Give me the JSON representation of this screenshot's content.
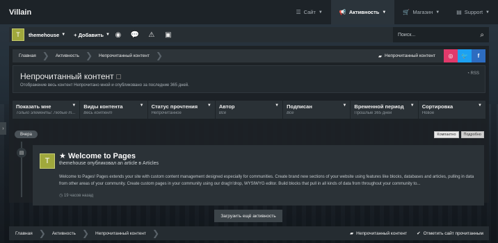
{
  "app": {
    "brand": "Villain"
  },
  "topnav": {
    "items": [
      {
        "icon": "list-icon",
        "label": "Сайт",
        "active": false
      },
      {
        "icon": "megaphone-icon",
        "label": "Активность",
        "active": true
      },
      {
        "icon": "cart-icon",
        "label": "Магазин",
        "active": false
      },
      {
        "icon": "document-icon",
        "label": "Support",
        "active": false
      }
    ]
  },
  "subbar": {
    "avatar_letter": "T",
    "username": "themehouse",
    "add_label": "+ Добавить",
    "search_placeholder": "Поиск..."
  },
  "breadcrumb": {
    "items": [
      "Главная",
      "Активность",
      "Непрочитанный контент"
    ],
    "unread_button": "Непрочитанный контент"
  },
  "social": {
    "colors": {
      "instagram": "#e23a6b",
      "twitter": "#1da1f2",
      "facebook": "#2d6cc0"
    }
  },
  "header": {
    "title": "Непрочитанный контент",
    "description": "Отображение весь контент Непрочитано мной и опубликовано за последние 365 дней.",
    "rss": "RSS"
  },
  "filters": [
    {
      "label": "Показать мне",
      "value": "Только элементы: Любые т...",
      "italic": true
    },
    {
      "label": "Виды контента",
      "value": "Весь контент",
      "italic": true
    },
    {
      "label": "Статус прочтения",
      "value": "Непрочитанное",
      "italic": false
    },
    {
      "label": "Автор",
      "value": "Все",
      "italic": true
    },
    {
      "label": "Подписан",
      "value": "Все",
      "italic": true
    },
    {
      "label": "Временной период",
      "value": "Прошлые 365 дней",
      "italic": false
    },
    {
      "label": "Сортировка",
      "value": "Новое",
      "italic": false
    }
  ],
  "timeline": {
    "date_label": "Вчера",
    "view_options": [
      "Компактно",
      "Подробно"
    ]
  },
  "post": {
    "avatar_letter": "T",
    "title": "Welcome to Pages",
    "subtitle": "themehouse опубликовал an article в Articles",
    "body": "Welcome to Pages! Pages extends your site with custom content management designed especially for communities. Create brand new sections of your website using features like blocks, databases and articles, pulling in data from other areas of your community. Create custom pages in your community using our drag'n'drop, WYSIWYG editor. Build blocks that pull in all kinds of data from throughout your community to...",
    "time": "19 часов назад"
  },
  "load_more": "Загрузить ещё активность",
  "bottombar": {
    "crumbs": [
      "Главная",
      "Активность",
      "Непрочитанный контент"
    ],
    "unread": "Непрочитанный контент",
    "mark_read": "Отметить сайт прочитанным"
  }
}
